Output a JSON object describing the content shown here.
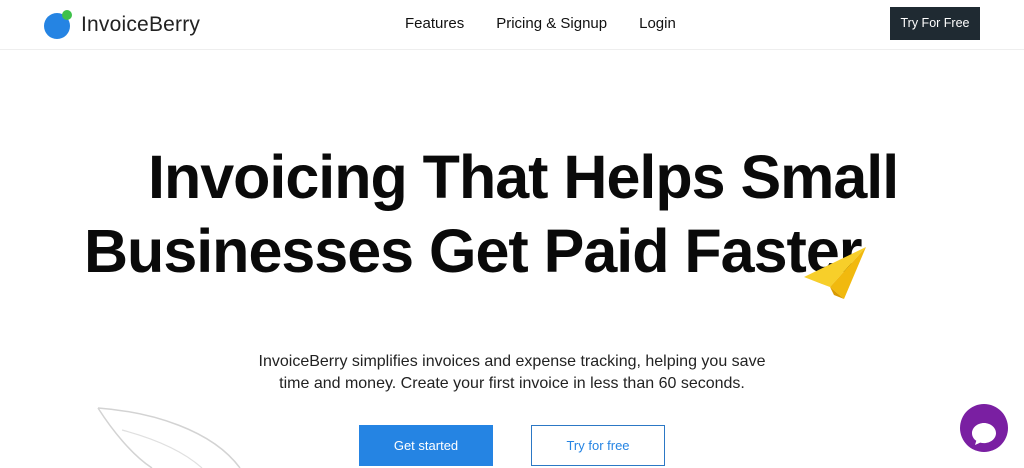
{
  "header": {
    "brand": "InvoiceBerry",
    "nav": [
      "Features",
      "Pricing & Signup",
      "Login"
    ],
    "cta_label": "Try For Free"
  },
  "hero": {
    "headline_line1": "Invoicing That Helps Small",
    "headline_line2": "Businesses Get Paid Faster",
    "subtitle_line1": "InvoiceBerry simplifies invoices and expense tracking, helping you save",
    "subtitle_line2": "time and money. Create your first invoice in less than 60 seconds.",
    "primary_button": "Get started",
    "secondary_button": "Try for free"
  },
  "icons": {
    "logo": "berry-logo-icon",
    "plane": "paper-plane-icon",
    "leaf": "leaf-outline-icon",
    "chat": "chat-bubble-icon"
  },
  "colors": {
    "primary_blue": "#2584e3",
    "dark_button": "#1f2a32",
    "chat_purple": "#7a1fa2",
    "plane_yellow": "#f5c518",
    "logo_green": "#3ec14a"
  }
}
